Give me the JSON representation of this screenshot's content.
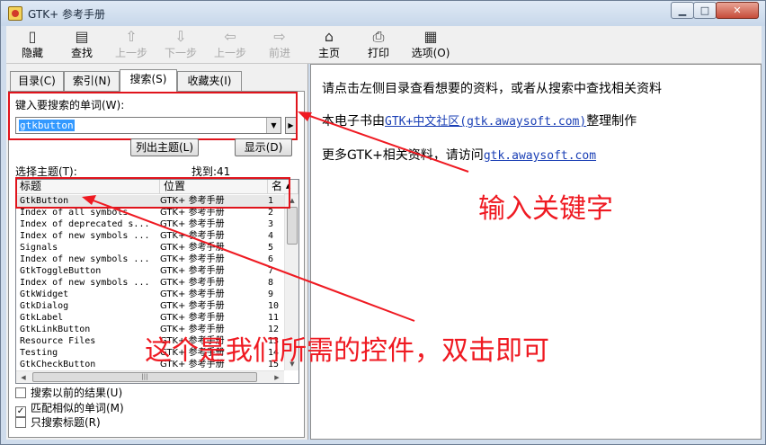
{
  "window": {
    "title": "GTK+ 参考手册",
    "controls": {
      "minimize": "▁",
      "maximize": "□",
      "close": "✕"
    }
  },
  "toolbar": {
    "items": [
      {
        "label": "隐藏",
        "icon": "▯",
        "enabled": true
      },
      {
        "label": "查找",
        "icon": "▤",
        "enabled": true
      },
      {
        "label": "上一步",
        "icon": "⇧",
        "enabled": false
      },
      {
        "label": "下一步",
        "icon": "⇩",
        "enabled": false
      },
      {
        "label": "上一步",
        "icon": "⇦",
        "enabled": false
      },
      {
        "label": "前进",
        "icon": "⇨",
        "enabled": false
      },
      {
        "label": "主页",
        "icon": "⌂",
        "enabled": true
      },
      {
        "label": "打印",
        "icon": "⎙",
        "enabled": true
      },
      {
        "label": "选项(O)",
        "icon": "▦",
        "enabled": true
      }
    ]
  },
  "tabs": [
    {
      "label": "目录(C)",
      "active": false
    },
    {
      "label": "索引(N)",
      "active": false
    },
    {
      "label": "搜索(S)",
      "active": true
    },
    {
      "label": "收藏夹(I)",
      "active": false
    }
  ],
  "search": {
    "prompt_label": "键入要搜索的单词(W):",
    "keyword": "gtkbutton",
    "dropdown_arrow": "▼",
    "go_arrow": "▶",
    "list_topics_button": "列出主题(L)",
    "display_button": "显示(D)",
    "select_topic_label": "选择主题(T):",
    "found_label": "找到:41"
  },
  "results": {
    "columns": [
      "标题",
      "位置",
      "名"
    ],
    "sort_indicator": "▲",
    "rows": [
      {
        "title": "GtkButton",
        "location": "GTK+ 参考手册",
        "rank": "1"
      },
      {
        "title": "Index of all symbols",
        "location": "GTK+ 参考手册",
        "rank": "2"
      },
      {
        "title": "Index of deprecated s...",
        "location": "GTK+ 参考手册",
        "rank": "3"
      },
      {
        "title": "Index of new symbols ...",
        "location": "GTK+ 参考手册",
        "rank": "4"
      },
      {
        "title": "Signals",
        "location": "GTK+ 参考手册",
        "rank": "5"
      },
      {
        "title": "Index of new symbols ...",
        "location": "GTK+ 参考手册",
        "rank": "6"
      },
      {
        "title": "GtkToggleButton",
        "location": "GTK+ 参考手册",
        "rank": "7"
      },
      {
        "title": "Index of new symbols ...",
        "location": "GTK+ 参考手册",
        "rank": "8"
      },
      {
        "title": "GtkWidget",
        "location": "GTK+ 参考手册",
        "rank": "9"
      },
      {
        "title": "GtkDialog",
        "location": "GTK+ 参考手册",
        "rank": "10"
      },
      {
        "title": "GtkLabel",
        "location": "GTK+ 参考手册",
        "rank": "11"
      },
      {
        "title": "GtkLinkButton",
        "location": "GTK+ 参考手册",
        "rank": "12"
      },
      {
        "title": "Resource Files",
        "location": "GTK+ 参考手册",
        "rank": "13"
      },
      {
        "title": "Testing",
        "location": "GTK+ 参考手册",
        "rank": "14"
      },
      {
        "title": "GtkCheckButton",
        "location": "GTK+ 参考手册",
        "rank": "15"
      }
    ],
    "scroll_up": "▲",
    "scroll_down": "▼",
    "scroll_left": "◀",
    "scroll_right": "▶",
    "scroll_grip": "|||"
  },
  "options": [
    {
      "label": "搜索以前的结果(U)",
      "checked": false
    },
    {
      "label": "匹配相似的单词(M)",
      "checked": true
    },
    {
      "label": "只搜索标题(R)",
      "checked": false
    }
  ],
  "content": {
    "line1": "请点击左侧目录查看想要的资料，或者从搜索中查找相关资料",
    "line2_prefix": "本电子书由",
    "line2_link": "GTK+中文社区(gtk.awaysoft.com)",
    "line2_suffix": "整理制作",
    "line3_prefix": "更多GTK+相关资料，请访问",
    "line3_link": "gtk.awaysoft.com"
  },
  "annotations": {
    "keyword_hint": "输入关键字",
    "control_hint": "这个是我们所需的控件，双击即可",
    "color": "#ef1a22"
  }
}
